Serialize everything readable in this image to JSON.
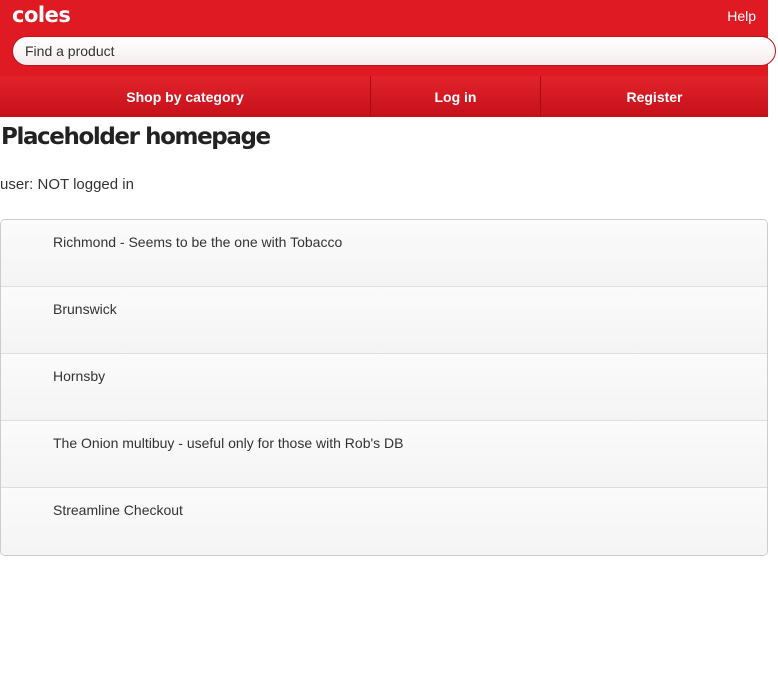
{
  "header": {
    "logo_text": "coles",
    "help_label": "Help",
    "search_placeholder": "Find a product"
  },
  "nav": {
    "items": [
      {
        "label": "Shop by category"
      },
      {
        "label": "Log in"
      },
      {
        "label": "Register"
      }
    ]
  },
  "main": {
    "title": "Placeholder homepage",
    "user_status": "user: NOT logged in",
    "list_items": [
      {
        "label": "Richmond - Seems to be the one with Tobacco"
      },
      {
        "label": "Brunswick"
      },
      {
        "label": "Hornsby"
      },
      {
        "label": "The Onion multibuy - useful only for those with Rob's DB"
      },
      {
        "label": "Streamline Checkout"
      }
    ]
  },
  "colors": {
    "brand_red": "#e01a22",
    "text_dark": "#333333"
  }
}
